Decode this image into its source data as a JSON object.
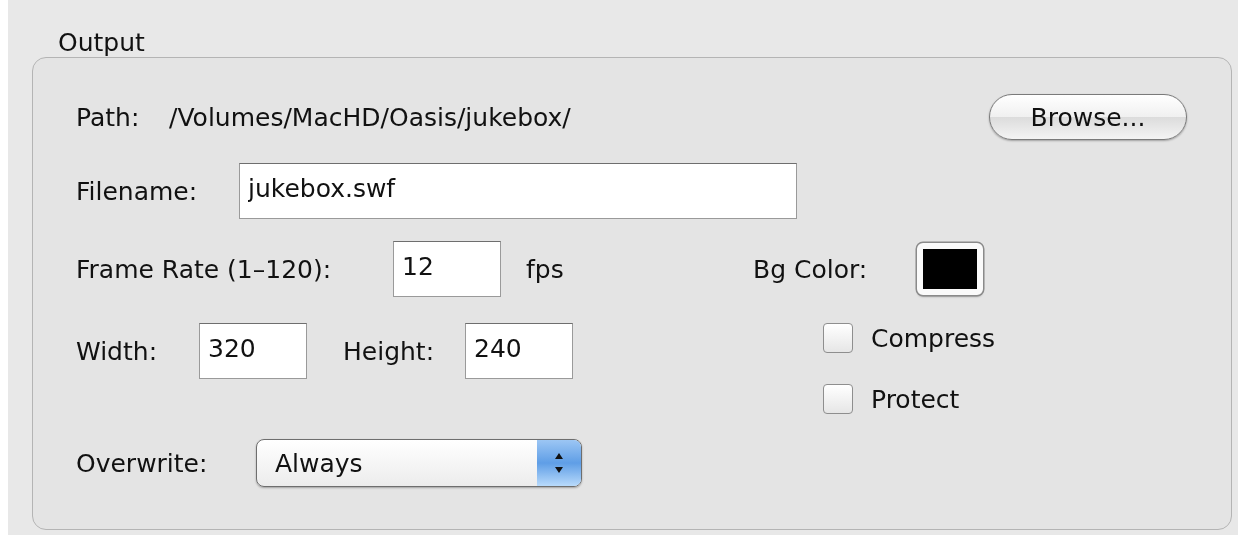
{
  "group": {
    "title": "Output"
  },
  "path": {
    "label": "Path:",
    "value": "/Volumes/MacHD/Oasis/jukebox/"
  },
  "browse_button": {
    "label": "Browse..."
  },
  "filename": {
    "label": "Filename:",
    "value": "jukebox.swf"
  },
  "frame_rate": {
    "label": "Frame Rate (1–120):",
    "value": "12",
    "unit": "fps"
  },
  "bg_color": {
    "label": "Bg Color:",
    "color": "#000000"
  },
  "width": {
    "label": "Width:",
    "value": "320"
  },
  "height": {
    "label": "Height:",
    "value": "240"
  },
  "options": [
    {
      "label": "Compress",
      "checked": false
    },
    {
      "label": "Protect",
      "checked": false
    }
  ],
  "overwrite": {
    "label": "Overwrite:",
    "value": "Always"
  }
}
